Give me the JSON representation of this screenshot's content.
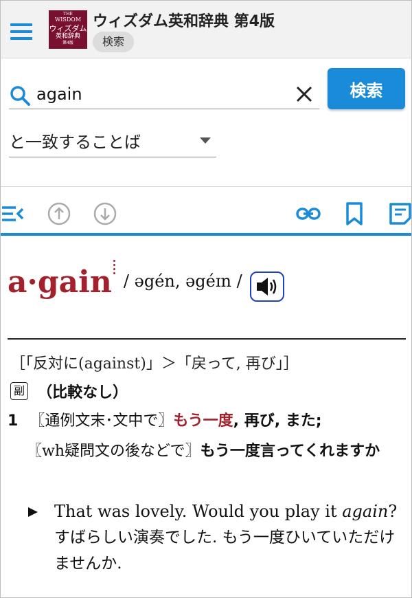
{
  "header": {
    "app_title": "ウィズダム英和辞典 第4版",
    "tab_label": "検索",
    "book_cover": {
      "line1": "THE",
      "line2": "WISDOM",
      "line3": "ウィズダム",
      "line4": "英和辞典",
      "line5": "第4版"
    }
  },
  "search": {
    "value": "again",
    "button_label": "検索",
    "match_mode": "と一致することば"
  },
  "toolbar": {
    "icons": [
      "toc-icon",
      "arrow-up-circle-icon",
      "arrow-down-circle-icon",
      "link-icon",
      "bookmark-icon",
      "note-icon"
    ]
  },
  "entry": {
    "headword": "a·gain",
    "pronunciation": "/ əgén, əgéɪn /",
    "etymology": "［「反対に(against)」＞「戻って, 再び」］",
    "pos_badge": "副",
    "pos_note": "（比較なし）",
    "sense": {
      "number": "1",
      "usage_1": "〖通例文末･文中で〗",
      "translation_main": "もう一度",
      "translation_rest": ", 再び, また;",
      "usage_2": "〖wh疑問文の後などで〗",
      "translation_2": "もう一度言ってくれますか"
    },
    "example": {
      "en_prefix": "That was lovely. Would you play it",
      "en_italic": "again",
      "en_suffix": "?",
      "ja": "すばらしい演奏でした. もう一度ひいていただけませんか."
    }
  },
  "colors": {
    "accent": "#1a8bd8",
    "headword": "#a2212c",
    "audio_border": "#2040c0"
  }
}
